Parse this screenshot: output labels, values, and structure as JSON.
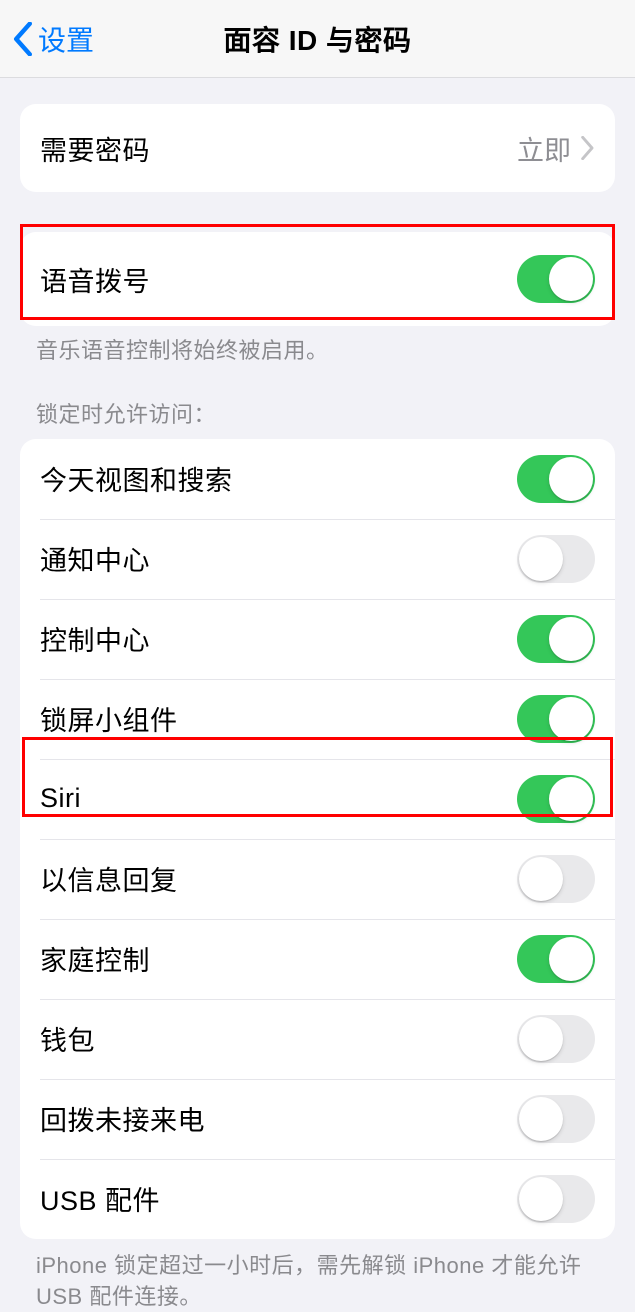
{
  "nav": {
    "back_label": "设置",
    "title": "面容 ID 与密码"
  },
  "group1": {
    "require_passcode": "需要密码",
    "require_passcode_value": "立即"
  },
  "group2": {
    "voice_dial": "语音拨号",
    "voice_dial_on": true,
    "footer": "音乐语音控制将始终被启用。"
  },
  "group3": {
    "header": "锁定时允许访问：",
    "items": [
      {
        "label": "今天视图和搜索",
        "on": true
      },
      {
        "label": "通知中心",
        "on": false
      },
      {
        "label": "控制中心",
        "on": true
      },
      {
        "label": "锁屏小组件",
        "on": true
      },
      {
        "label": "Siri",
        "on": true
      },
      {
        "label": "以信息回复",
        "on": false
      },
      {
        "label": "家庭控制",
        "on": true
      },
      {
        "label": "钱包",
        "on": false
      },
      {
        "label": "回拨未接来电",
        "on": false
      },
      {
        "label": "USB 配件",
        "on": false
      }
    ],
    "footer": "iPhone 锁定超过一小时后，需先解锁 iPhone 才能允许 USB 配件连接。"
  }
}
